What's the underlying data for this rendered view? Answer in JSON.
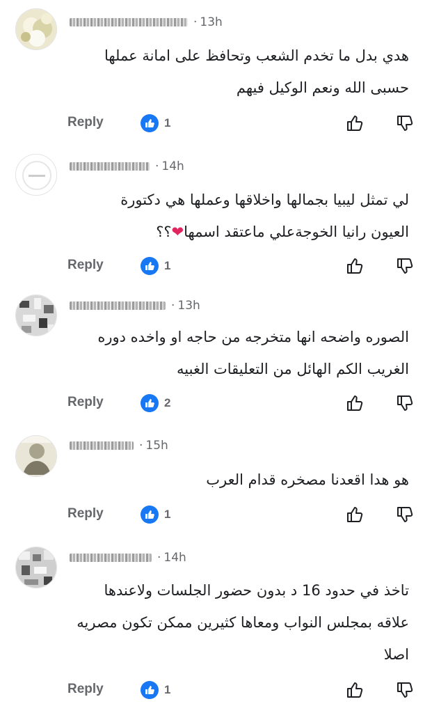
{
  "icons": {
    "avatar": "user-avatar",
    "reaction": "like-reaction-icon",
    "upvote": "thumbs-up-outline-icon",
    "downvote": "thumbs-down-outline-icon"
  },
  "colors": {
    "like_blue": "#1877f2",
    "secondary_text": "#65676b",
    "primary_text": "#1c1e21",
    "heart": "#e0245e"
  },
  "comments": [
    {
      "time": "13h",
      "lines": [
        "هدي بدل ما تخدم الشعب وتحافظ على امانة عملها",
        "حسبى الله ونعم الوكيل فيهم"
      ],
      "reply_label": "Reply",
      "reaction_count": "1"
    },
    {
      "time": "14h",
      "lines": [
        "لي تمثل ليبيا بجمالها واخلاقها وعملها هي دكتورة",
        "العيون رانيا الخوجةعلي ماعتقد اسمها",
        "؟؟"
      ],
      "reply_label": "Reply",
      "reaction_count": "1"
    },
    {
      "time": "13h",
      "lines": [
        "الصوره واضحه انها متخرجه من حاجه او واخده دوره",
        "الغريب الكم الهائل من التعليقات الغبيه"
      ],
      "reply_label": "Reply",
      "reaction_count": "2"
    },
    {
      "time": "15h",
      "lines": [
        "هو هدا اقعدنا مصخره قدام العرب"
      ],
      "reply_label": "Reply",
      "reaction_count": "1"
    },
    {
      "time": "14h",
      "lines": [
        "تاخذ في حدود 16 د بدون حضور الجلسات ولاعندها",
        "علاقه بمجلس النواب ومعاها كثيرين ممكن تكون مصريه",
        "اصلا"
      ],
      "reply_label": "Reply",
      "reaction_count": "1"
    }
  ]
}
